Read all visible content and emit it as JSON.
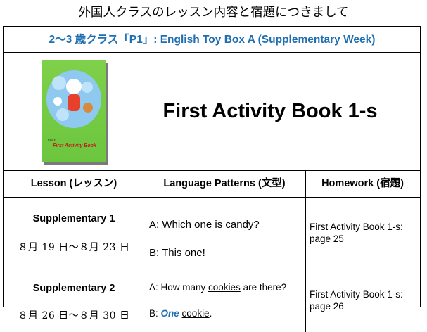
{
  "doc_title": "外国人クラスのレッスン内容と宿題につきまして",
  "class_title": "2～3 歳クラス「P1」: English Toy Box A (Supplementary Week)",
  "book": {
    "name": "First Activity Book 1-s",
    "cover_title": "First Activity Book",
    "cover_sub": "early"
  },
  "columns": {
    "lesson": "Lesson (レッスン)",
    "patterns": "Language Patterns (文型)",
    "homework": "Homework (宿題)"
  },
  "rows": [
    {
      "lesson": "Supplementary 1",
      "dates": "８月 19 日～８月 23 日",
      "pattern_a_prefix": "A: Which one is ",
      "pattern_a_word": "candy",
      "pattern_a_suffix": "?",
      "pattern_b": "B: This one!",
      "homework": "First Activity Book 1-s: page 25"
    },
    {
      "lesson": "Supplementary 2",
      "dates": "８月 26 日～８月 30 日",
      "pattern_a_prefix": "A: How many ",
      "pattern_a_word": "cookies",
      "pattern_a_suffix": " are there?",
      "pattern_b_prefix": "B: ",
      "pattern_b_em": "One",
      "pattern_b_space": " ",
      "pattern_b_word": "cookie",
      "pattern_b_suffix": ".",
      "homework": "First Activity Book 1-s: page 26"
    }
  ],
  "colors": {
    "accent": "#1f6fb0",
    "cover_green": "#6cc63e"
  }
}
